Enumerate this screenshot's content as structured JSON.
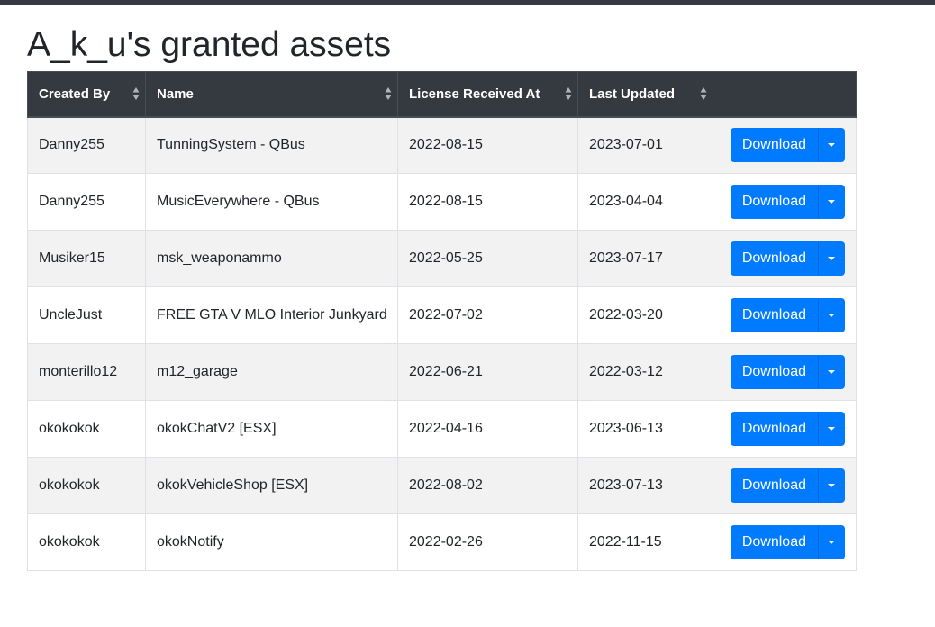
{
  "page": {
    "title": "A_k_u's granted assets"
  },
  "table": {
    "columns": [
      {
        "label": "Created By",
        "sortable": true
      },
      {
        "label": "Name",
        "sortable": true
      },
      {
        "label": "License Received At",
        "sortable": true
      },
      {
        "label": "Last Updated",
        "sortable": true
      },
      {
        "label": "",
        "sortable": false
      }
    ],
    "download_label": "Download",
    "rows": [
      {
        "created_by": "Danny255",
        "name": "TunningSystem - QBus",
        "license_received_at": "2022-08-15",
        "last_updated": "2023-07-01"
      },
      {
        "created_by": "Danny255",
        "name": "MusicEverywhere - QBus",
        "license_received_at": "2022-08-15",
        "last_updated": "2023-04-04"
      },
      {
        "created_by": "Musiker15",
        "name": "msk_weaponammo",
        "license_received_at": "2022-05-25",
        "last_updated": "2023-07-17"
      },
      {
        "created_by": "UncleJust",
        "name": "FREE GTA V MLO Interior Junkyard",
        "license_received_at": "2022-07-02",
        "last_updated": "2022-03-20"
      },
      {
        "created_by": "monterillo12",
        "name": "m12_garage",
        "license_received_at": "2022-06-21",
        "last_updated": "2022-03-12"
      },
      {
        "created_by": "okokokok",
        "name": "okokChatV2 [ESX]",
        "license_received_at": "2022-04-16",
        "last_updated": "2023-06-13"
      },
      {
        "created_by": "okokokok",
        "name": "okokVehicleShop [ESX]",
        "license_received_at": "2022-08-02",
        "last_updated": "2023-07-13"
      },
      {
        "created_by": "okokokok",
        "name": "okokNotify",
        "license_received_at": "2022-02-26",
        "last_updated": "2022-11-15"
      }
    ]
  },
  "colors": {
    "header_bg": "#343a40",
    "accent": "#007bff",
    "stripe": "#f2f2f2",
    "border": "#dee2e6"
  },
  "icons": {
    "sort": "sort-icon",
    "dropdown": "caret-down-icon"
  }
}
